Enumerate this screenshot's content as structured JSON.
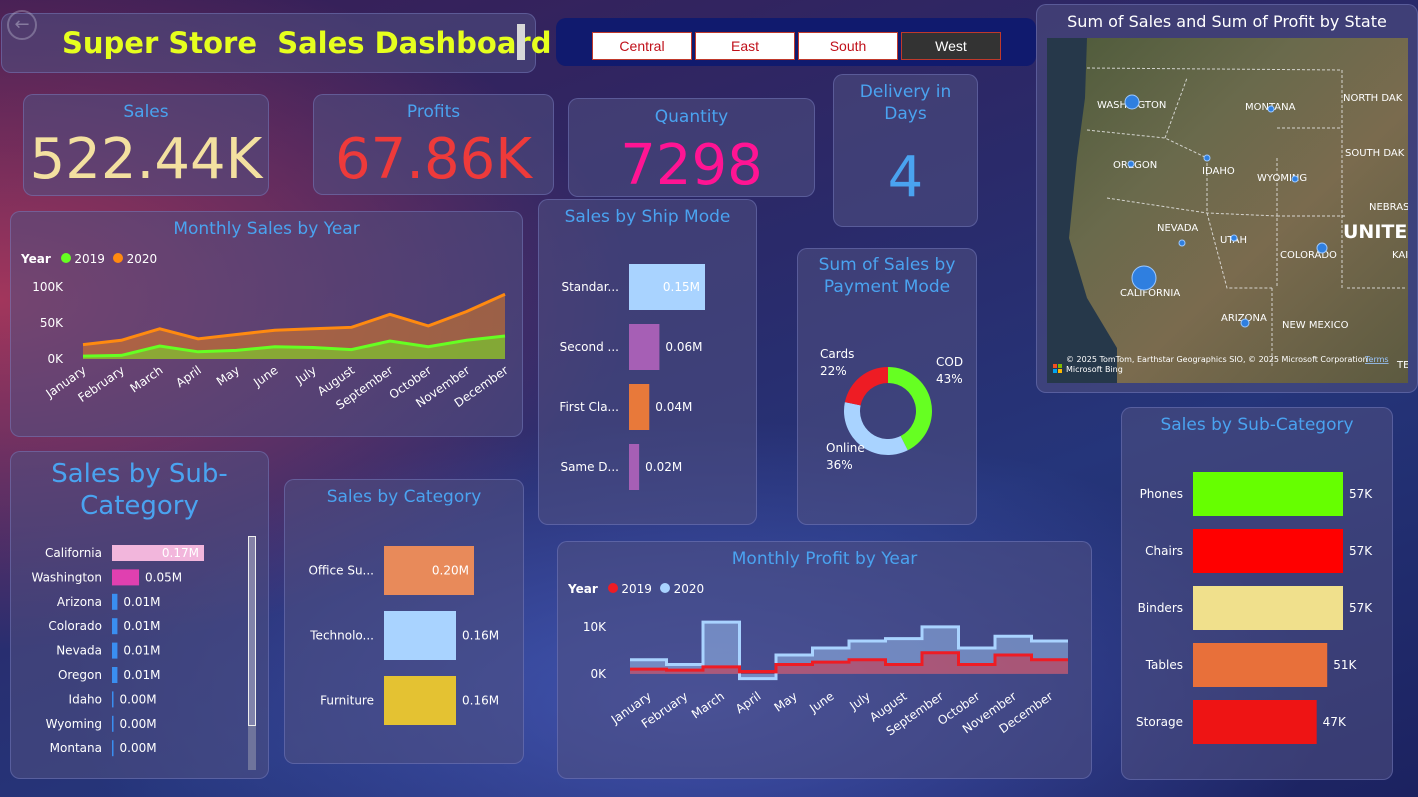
{
  "header": {
    "title": "Super Store  Sales Dashboard"
  },
  "regions": [
    "Central",
    "East",
    "South",
    "West"
  ],
  "kpis": {
    "sales": {
      "label": "Sales",
      "value": "522.44K"
    },
    "profits": {
      "label": "Profits",
      "value": "67.86K"
    },
    "quantity": {
      "label": "Quantity",
      "value": "7298"
    },
    "delivery": {
      "label": "Delivery in Days",
      "value": "4"
    }
  },
  "map": {
    "title": "Sum of Sales and Sum of Profit by State",
    "labels": [
      "WASHINGTON",
      "MONTANA",
      "NORTH DAK",
      "OREGON",
      "IDAHO",
      "WYOMING",
      "SOUTH DAK",
      "NEVADA",
      "UTAH",
      "UNITED",
      "NEBRAS",
      "COLORADO",
      "KAI",
      "CALIFORNIA",
      "ARIZONA",
      "NEW MEXICO",
      "TEX"
    ],
    "attribution": "© 2025 TomTom, Earthstar Geographics SIO, © 2025 Microsoft Corporation",
    "terms": "Terms",
    "bing": "Microsoft Bing"
  },
  "chart_data": [
    {
      "type": "area",
      "title": "Monthly Sales by Year",
      "legend_title": "Year",
      "categories": [
        "January",
        "February",
        "March",
        "April",
        "May",
        "June",
        "July",
        "August",
        "September",
        "October",
        "November",
        "December"
      ],
      "series": [
        {
          "name": "2019",
          "color": "#66ff22",
          "values": [
            4,
            5,
            18,
            10,
            12,
            17,
            16,
            13,
            25,
            17,
            26,
            32
          ]
        },
        {
          "name": "2020",
          "color": "#ff8a10",
          "values": [
            20,
            26,
            42,
            28,
            34,
            40,
            42,
            44,
            62,
            46,
            66,
            90
          ]
        }
      ],
      "ytick_labels": [
        "100K",
        "50K",
        "0K"
      ],
      "ylim": [
        0,
        100
      ]
    },
    {
      "type": "bar",
      "title": "Sales by Ship Mode",
      "categories": [
        "Standar...",
        "Second ...",
        "First Cla...",
        "Same D..."
      ],
      "values": [
        0.15,
        0.06,
        0.04,
        0.02
      ],
      "labels": [
        "0.15M",
        "0.06M",
        "0.04M",
        "0.02M"
      ],
      "colors": [
        "#a9d3ff",
        "#a65fb5",
        "#e8793a",
        "#a65fb5"
      ]
    },
    {
      "type": "pie",
      "title": "Sum of Sales by Payment Mode",
      "slices": [
        {
          "name": "COD",
          "value": 43,
          "label": "43%",
          "color": "#66ff22"
        },
        {
          "name": "Online",
          "value": 36,
          "label": "36%",
          "color": "#a9d3ff"
        },
        {
          "name": "Cards",
          "value": 22,
          "label": "22%",
          "color": "#ee1c24"
        }
      ]
    },
    {
      "type": "bar",
      "title": "Sales by Sub-Category",
      "categories": [
        "California",
        "Washington",
        "Arizona",
        "Colorado",
        "Nevada",
        "Oregon",
        "Idaho",
        "Wyoming",
        "Montana"
      ],
      "values": [
        0.17,
        0.05,
        0.01,
        0.01,
        0.01,
        0.01,
        0.0,
        0.0,
        0.0
      ],
      "labels": [
        "0.17M",
        "0.05M",
        "0.01M",
        "0.01M",
        "0.01M",
        "0.01M",
        "0.00M",
        "0.00M",
        "0.00M"
      ]
    },
    {
      "type": "bar",
      "title": "Sales by Category",
      "categories": [
        "Office Su...",
        "Technolo...",
        "Furniture"
      ],
      "values": [
        0.2,
        0.16,
        0.16
      ],
      "labels": [
        "0.20M",
        "0.16M",
        "0.16M"
      ],
      "colors": [
        "#e88a5a",
        "#a9d3ff",
        "#e4c232"
      ]
    },
    {
      "type": "area",
      "title": "Monthly Profit by Year",
      "legend_title": "Year",
      "categories": [
        "January",
        "February",
        "March",
        "April",
        "May",
        "June",
        "July",
        "August",
        "September",
        "October",
        "November",
        "December"
      ],
      "series": [
        {
          "name": "2019",
          "color": "#ee1c24",
          "values": [
            1,
            0.8,
            1.5,
            0.5,
            2,
            2.5,
            3,
            2,
            4.5,
            2,
            4,
            3
          ]
        },
        {
          "name": "2020",
          "color": "#a9d3ff",
          "values": [
            3,
            2,
            11,
            -1,
            4,
            5.5,
            7,
            7.5,
            10,
            5.5,
            8,
            7
          ]
        }
      ],
      "ytick_labels": [
        "10K",
        "0K"
      ],
      "ylim": [
        -3,
        14
      ]
    },
    {
      "type": "bar",
      "title": "Sales by Sub-Category",
      "categories": [
        "Phones",
        "Chairs",
        "Binders",
        "Tables",
        "Storage"
      ],
      "values": [
        57,
        57,
        57,
        51,
        47
      ],
      "labels": [
        "57K",
        "57K",
        "57K",
        "51K",
        "47K"
      ],
      "colors": [
        "#66ff00",
        "#ff0000",
        "#f0e08c",
        "#e8703a",
        "#ee1414"
      ]
    }
  ]
}
